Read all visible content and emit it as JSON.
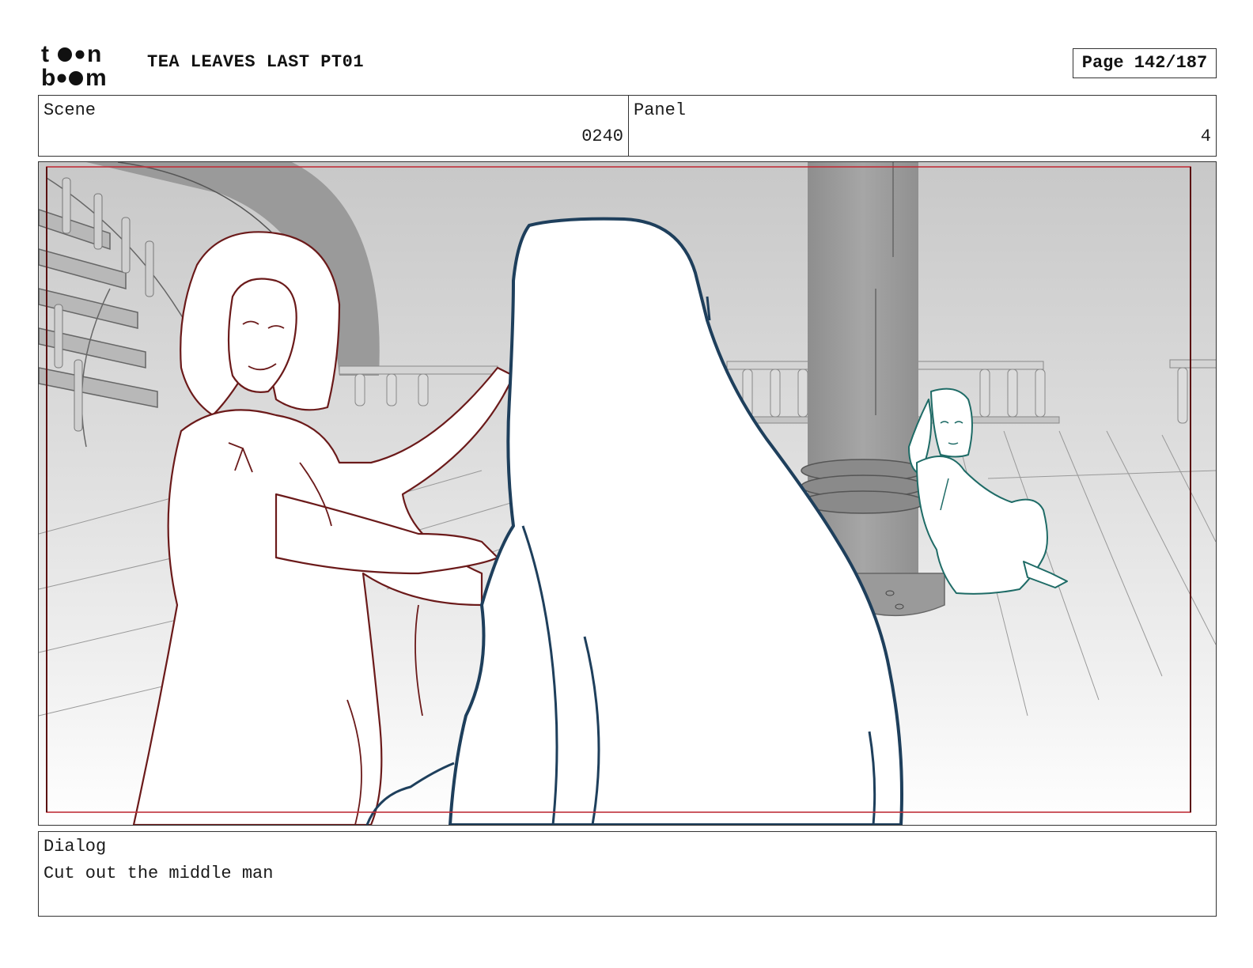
{
  "header": {
    "logo_icon": "toon-boom-logo",
    "project_title": "TEA LEAVES LAST PT01",
    "page_label": "Page 142/187"
  },
  "info": {
    "scene_label": "Scene",
    "scene_value": "0240",
    "panel_label": "Panel",
    "panel_value": "4"
  },
  "frame": {
    "image_icon": "storyboard-panel-drawing",
    "colors": {
      "left_character": "#6b1a1a",
      "center_character": "#1e3f5c",
      "right_character": "#1e6b66",
      "safe_frame": "#c0303a"
    }
  },
  "dialog": {
    "label": "Dialog",
    "text": "Cut out the middle man"
  }
}
